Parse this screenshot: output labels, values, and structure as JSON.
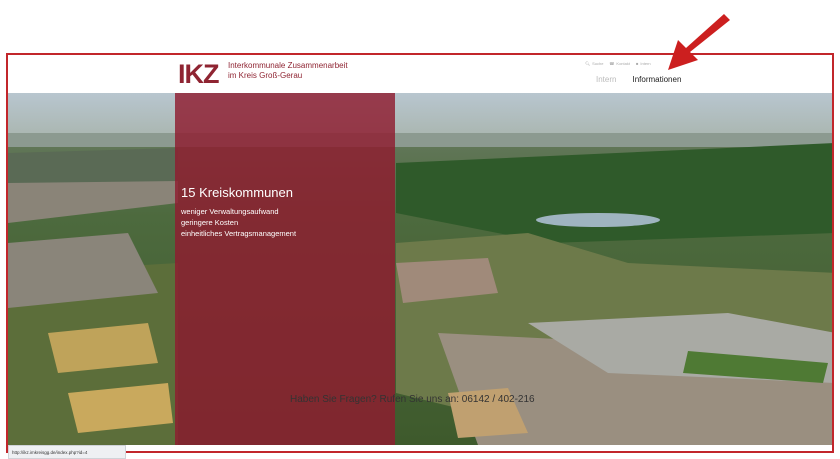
{
  "header": {
    "logo_mark": "IKZ",
    "logo_line1": "Interkommunale Zusammenarbeit",
    "logo_line2": "im Kreis Groß-Gerau",
    "util_items": [
      {
        "icon": "search-icon",
        "label": "Suche"
      },
      {
        "icon": "phone-icon",
        "label": "Kontakt"
      },
      {
        "icon": "lock-icon",
        "label": "Intern"
      }
    ],
    "nav": {
      "intern": "Intern",
      "informationen": "Informationen"
    }
  },
  "hero": {
    "title": "15 Kreiskommunen",
    "lines": [
      "weniger Verwaltungsaufwand",
      "geringere Kosten",
      "einheitliches Vertragsmanagement"
    ]
  },
  "footer": {
    "text": "Haben Sie Fragen? Rufen Sie uns an: 06142 / 402-216"
  },
  "status_bar": {
    "url": "http://ikz.imkreisgg.de/index.php?id=4"
  },
  "colors": {
    "brand": "#8f2432",
    "overlay": "#8f1c30",
    "frame": "#c2262b",
    "arrow": "#cc1f1f"
  }
}
